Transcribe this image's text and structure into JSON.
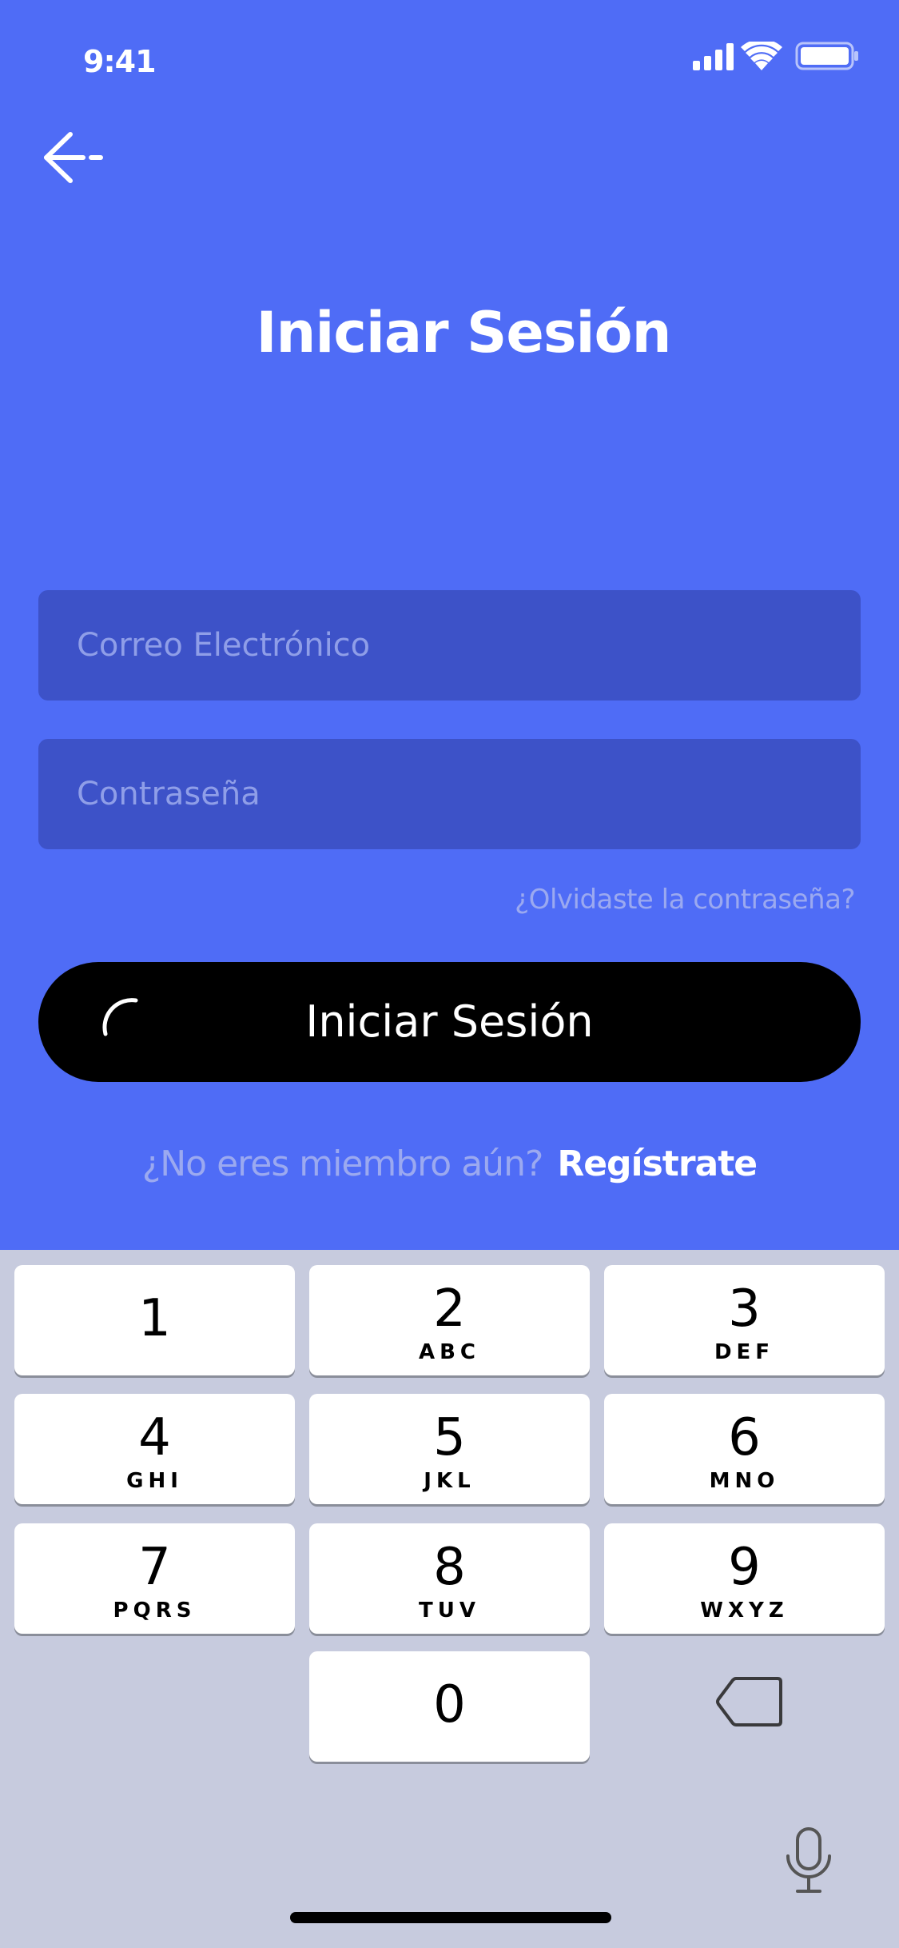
{
  "status_bar": {
    "time": "9:41"
  },
  "header": {
    "back_icon": "arrow-left-icon",
    "title": "Iniciar Sesión"
  },
  "form": {
    "email_placeholder": "Correo Electrónico",
    "email_value": "",
    "password_placeholder": "Contraseña",
    "password_value": "",
    "forgot_password": "¿Olvidaste la contraseña?",
    "login_button": "Iniciar Sesión",
    "login_loading": true
  },
  "register": {
    "prompt": "¿No eres miembro aún?",
    "link": "Regístrate"
  },
  "keypad": {
    "keys": [
      {
        "digit": "1",
        "letters": ""
      },
      {
        "digit": "2",
        "letters": "ABC"
      },
      {
        "digit": "3",
        "letters": "DEF"
      },
      {
        "digit": "4",
        "letters": "GHI"
      },
      {
        "digit": "5",
        "letters": "JKL"
      },
      {
        "digit": "6",
        "letters": "MNO"
      },
      {
        "digit": "7",
        "letters": "PQRS"
      },
      {
        "digit": "8",
        "letters": "TUV"
      },
      {
        "digit": "9",
        "letters": "WXYZ"
      },
      {
        "digit": "0",
        "letters": ""
      }
    ],
    "delete_icon": "backspace-icon",
    "mic_icon": "microphone-icon"
  },
  "colors": {
    "background": "#4F6CF6",
    "field_background": "#3D52C8",
    "placeholder": "#8F9EE8",
    "button": "#000000",
    "keypad_background": "#C7CBDE"
  }
}
